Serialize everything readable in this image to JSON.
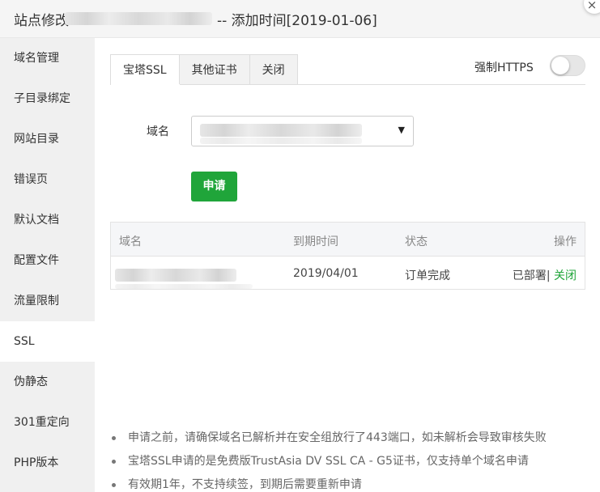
{
  "title": {
    "prefix": "站点修改",
    "suffix": "-- 添加时间[2019-01-06]",
    "close_icon": "×"
  },
  "sidebar": {
    "items": [
      {
        "label": "域名管理"
      },
      {
        "label": "子目录绑定"
      },
      {
        "label": "网站目录"
      },
      {
        "label": "错误页"
      },
      {
        "label": "默认文档"
      },
      {
        "label": "配置文件"
      },
      {
        "label": "流量限制"
      },
      {
        "label": "SSL",
        "active": true
      },
      {
        "label": "伪静态"
      },
      {
        "label": "301重定向"
      },
      {
        "label": "PHP版本"
      }
    ]
  },
  "tabs": [
    {
      "label": "宝塔SSL",
      "active": true
    },
    {
      "label": "其他证书"
    },
    {
      "label": "关闭"
    }
  ],
  "force_https": {
    "label": "强制HTTPS",
    "enabled": false
  },
  "form": {
    "domain_label": "域名",
    "select_arrow": "▼",
    "apply_label": "申请"
  },
  "table": {
    "headers": [
      "域名",
      "到期时间",
      "状态",
      "操作"
    ],
    "rows": [
      {
        "expiry": "2019/04/01",
        "status": "订单完成",
        "deployed": "已部署",
        "separator": "|",
        "close": "关闭"
      }
    ]
  },
  "notes": [
    "申请之前，请确保域名已解析并在安全组放行了443端口，如未解析会导致审核失败",
    "宝塔SSL申请的是免费版TrustAsia DV SSL CA - G5证书，仅支持单个域名申请",
    "有效期1年，不支持续签，到期后需要重新申请"
  ],
  "colors": {
    "accent": "#20a53a",
    "sidebar_bg": "#f0f0f0",
    "titlebar_bg": "#f5f5f5"
  }
}
